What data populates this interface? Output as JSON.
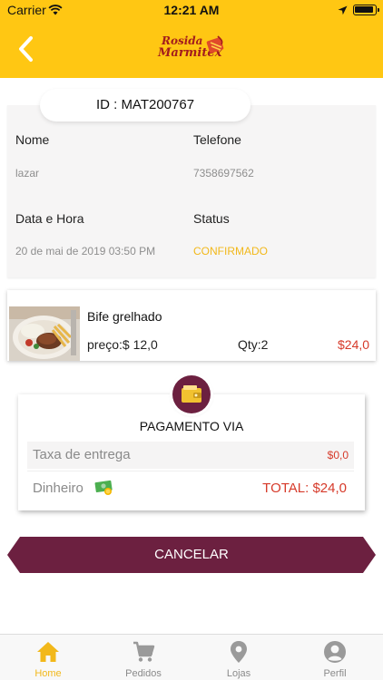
{
  "status_bar": {
    "carrier": "Carrier",
    "time": "12:21 AM"
  },
  "header": {
    "logo_line1": "Rosida",
    "logo_line2": "Marmitex",
    "accent_color": "#ffc713"
  },
  "order": {
    "id_text": "ID : MAT200767",
    "name_label": "Nome",
    "name_value": "lazar",
    "phone_label": "Telefone",
    "phone_value": "7358697562",
    "datetime_label": "Data e Hora",
    "datetime_value": "20 de mai de 2019 03:50 PM",
    "status_label": "Status",
    "status_value": "CONFIRMADO"
  },
  "items": [
    {
      "name": "Bife grelhado",
      "price": "preço:$ 12,0",
      "qty": "Qty:2",
      "total": "$24,0",
      "image_icon": "steak-plate-photo"
    }
  ],
  "payment": {
    "title": "PAGAMENTO VIA",
    "icon": "wallet-icon",
    "fee_label": "Taxa de entrega",
    "fee_value": "$0,0",
    "method_label": "Dinheiro",
    "method_icon": "cash-icon",
    "total": "TOTAL: $24,0"
  },
  "cancel_label": "CANCELAR",
  "brand_color": "#6c2040",
  "tabs": [
    {
      "label": "Home",
      "icon": "home-icon",
      "active": true
    },
    {
      "label": "Pedidos",
      "icon": "cart-icon",
      "active": false
    },
    {
      "label": "Lojas",
      "icon": "location-pin-icon",
      "active": false
    },
    {
      "label": "Perfil",
      "icon": "user-icon",
      "active": false
    }
  ]
}
